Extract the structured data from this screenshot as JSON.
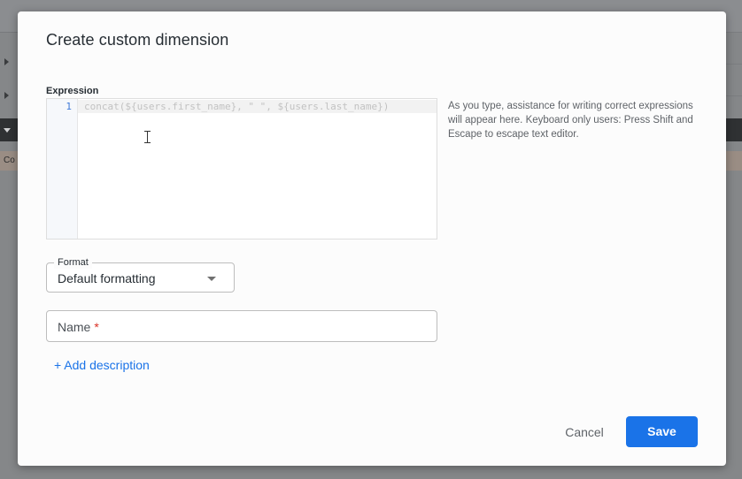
{
  "background": {
    "cell_text": "Co"
  },
  "dialog": {
    "title": "Create custom dimension",
    "expression": {
      "label": "Expression",
      "line_number": "1",
      "placeholder": "concat(${users.first_name}, \" \", ${users.last_name})",
      "assist_text": "As you type, assistance for writing correct expressions will appear here. Keyboard only users: Press Shift and Escape to escape text editor."
    },
    "format": {
      "label": "Format",
      "value": "Default formatting"
    },
    "name": {
      "label": "Name",
      "required_mark": "*"
    },
    "add_description": "+ Add description",
    "cancel_label": "Cancel",
    "save_label": "Save"
  },
  "colors": {
    "accent": "#1a73e8",
    "required": "#d93025",
    "overlay": "#858789"
  }
}
